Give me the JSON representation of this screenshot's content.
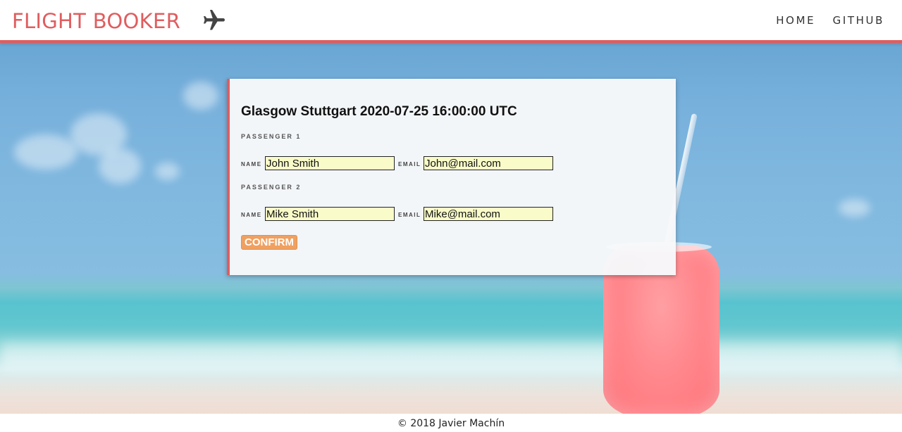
{
  "header": {
    "brand": "FLIGHT BOOKER",
    "brand_color": "#e05d5f",
    "logo_icon": "airplane-icon",
    "nav": [
      {
        "label": "HOME"
      },
      {
        "label": "GITHUB"
      }
    ]
  },
  "booking": {
    "title": "Glasgow Stuttgart 2020-07-25 16:00:00 UTC",
    "name_label": "NAME",
    "email_label": "EMAIL",
    "passengers": [
      {
        "label": "PASSENGER 1",
        "name": "John Smith",
        "email": "John@mail.com"
      },
      {
        "label": "PASSENGER 2",
        "name": "Mike Smith",
        "email": "Mike@mail.com"
      }
    ],
    "confirm_label": "CONFIRM",
    "confirm_color": "#f0a060",
    "input_bg": "#f9fcc8"
  },
  "footer": {
    "text": "© 2018 Javier Machín"
  }
}
